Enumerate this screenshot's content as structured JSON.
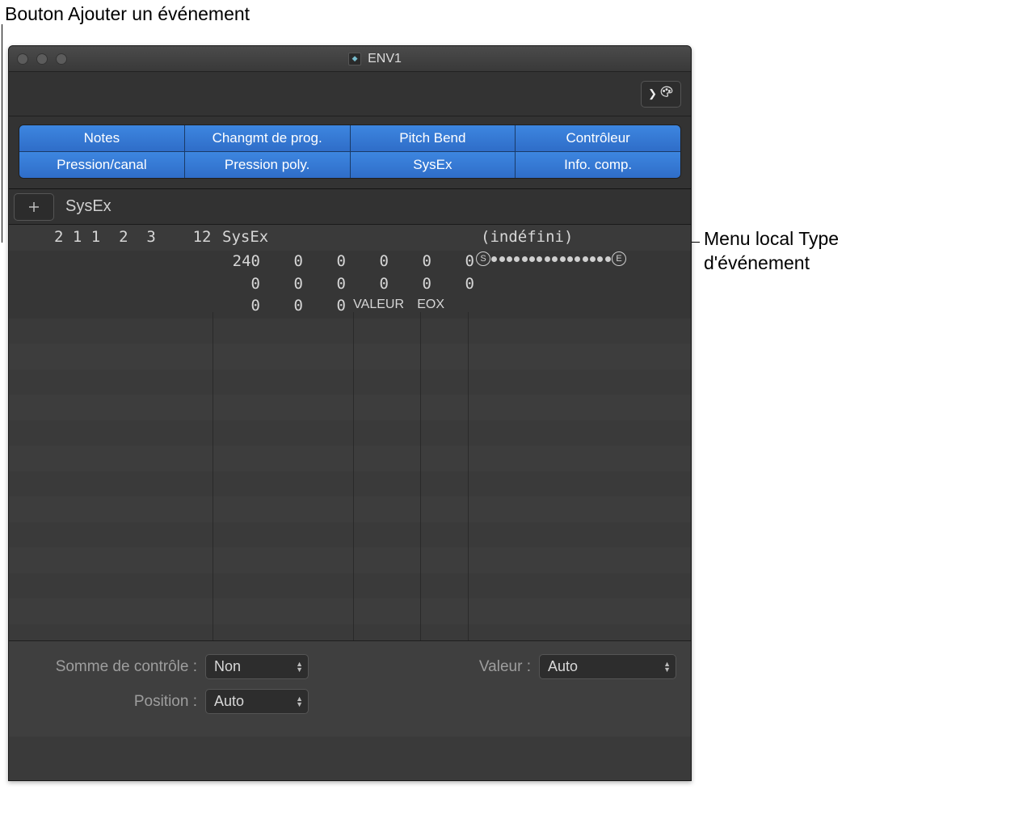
{
  "callouts": {
    "top": "Bouton Ajouter un événement",
    "right_line1": "Menu local Type",
    "right_line2": "d'événement"
  },
  "window": {
    "title": "ENV1"
  },
  "filters": {
    "row1": [
      "Notes",
      "Changmt de prog.",
      "Pitch Bend",
      "Contrôleur"
    ],
    "row2": [
      "Pression/canal",
      "Pression poly.",
      "SysEx",
      "Info. comp."
    ]
  },
  "event_type": "SysEx",
  "list": {
    "position": "2 1 1  2  3    12",
    "type_header": "SysEx",
    "def_header": "(indéfini)",
    "bytes": {
      "r1": [
        "240",
        "0",
        "0",
        "0",
        "0",
        "0"
      ],
      "r2": [
        "0",
        "0",
        "0",
        "0",
        "0",
        "0"
      ],
      "r3": [
        "0",
        "0",
        "0"
      ],
      "valeur": "VALEUR",
      "eox": "EOX"
    }
  },
  "footer": {
    "checksum_label": "Somme de contrôle :",
    "checksum_value": "Non",
    "valeur_label": "Valeur :",
    "valeur_value": "Auto",
    "position_label": "Position :",
    "position_value": "Auto"
  }
}
